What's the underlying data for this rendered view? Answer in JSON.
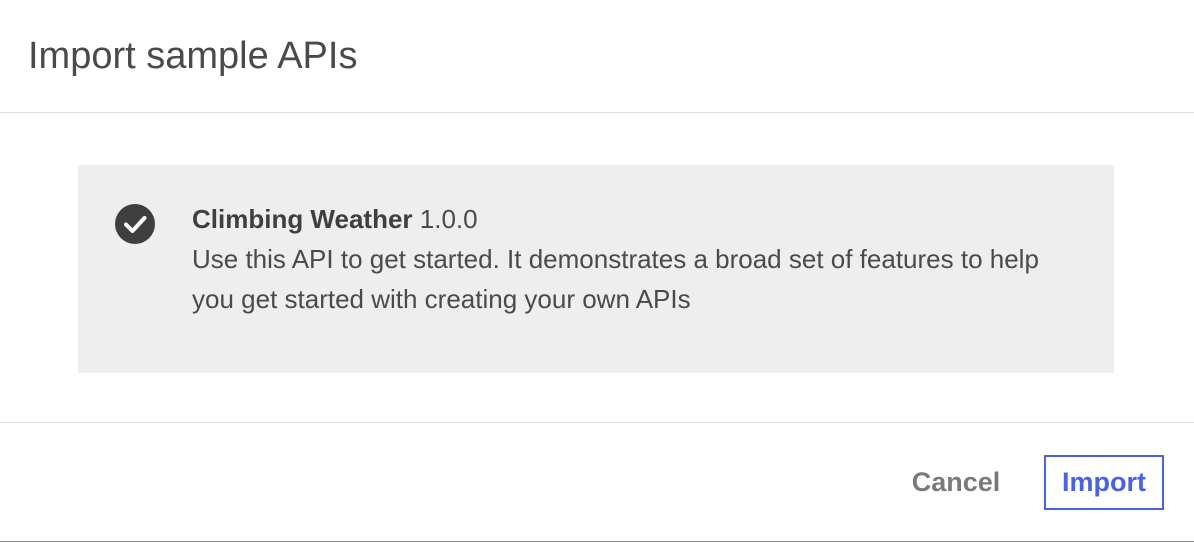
{
  "dialog": {
    "title": "Import sample APIs"
  },
  "api": {
    "name": "Climbing Weather",
    "version": "1.0.0",
    "description": "Use this API to get started. It demonstrates a broad set of features to help you get started with creating your own APIs",
    "selected": true,
    "check_icon": "check-circle-icon"
  },
  "footer": {
    "cancel_label": "Cancel",
    "import_label": "Import"
  },
  "colors": {
    "accent": "#4a63e0",
    "card_background": "#eeeeee",
    "check_icon": "#3f3f3f"
  }
}
